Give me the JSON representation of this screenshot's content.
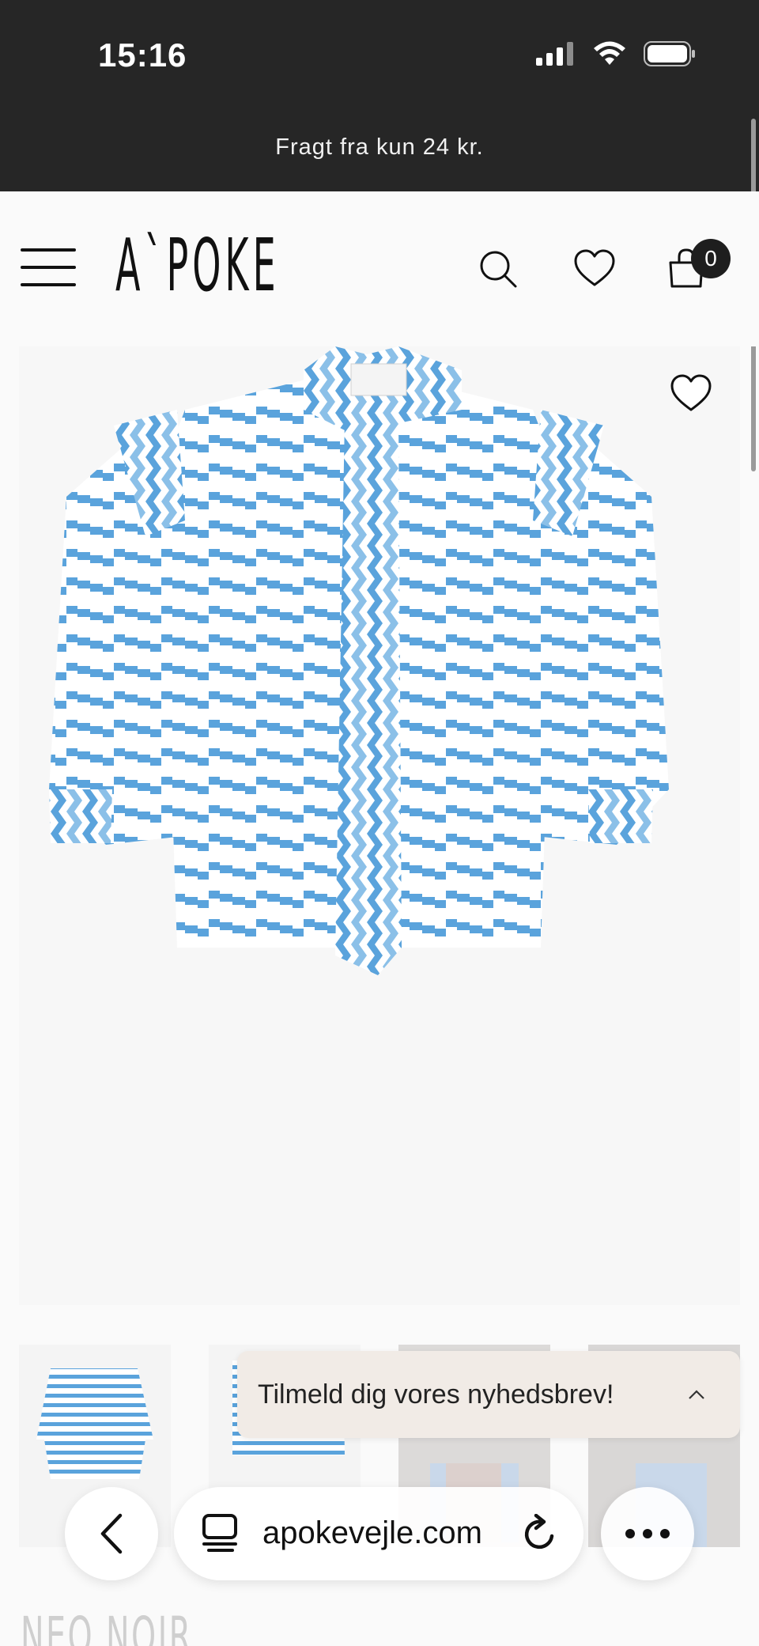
{
  "status_bar": {
    "time": "15:16",
    "icons": [
      "cellular-signal-icon",
      "wifi-icon",
      "battery-icon"
    ]
  },
  "announcement": {
    "text": "Fragt fra kun 24 kr."
  },
  "header": {
    "logo": "A`POKE",
    "cart_count": "0",
    "icons": [
      "menu-icon",
      "search-icon",
      "heart-icon",
      "cart-icon"
    ]
  },
  "product": {
    "image_alt": "Blue and white patterned blouse with ruffle details",
    "colors": {
      "print_blue": "#5aa3dc",
      "base_white": "#ffffff"
    }
  },
  "thumbnails": {
    "count": 4
  },
  "newsletter": {
    "label": "Tilmeld dig vores nyhedsbrev!"
  },
  "brand_teaser": {
    "text": "NEO NOIR"
  },
  "browser": {
    "url": "apokevejle.com",
    "icons": [
      "back-chevron-icon",
      "tabs-icon",
      "reload-icon",
      "more-icon"
    ]
  },
  "colors": {
    "status_bg": "#262626",
    "header_bg": "#fafafa",
    "newsletter_bg": "#f1ebe6",
    "badge_bg": "#1e1e1e"
  }
}
